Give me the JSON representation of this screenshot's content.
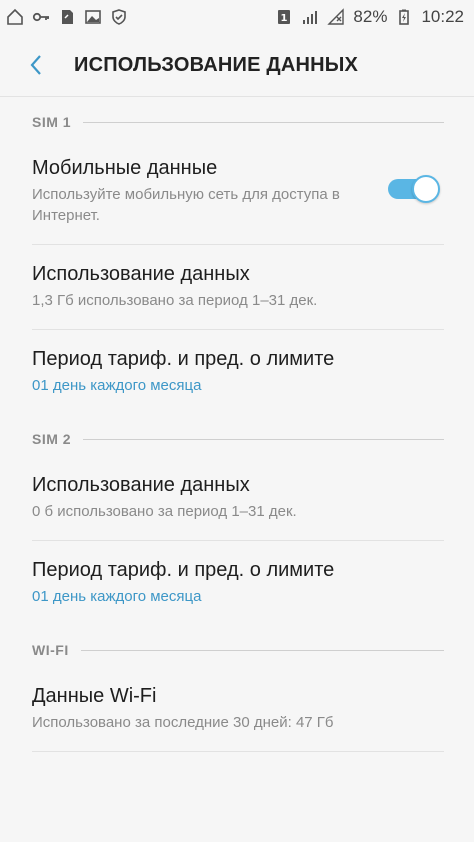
{
  "statusbar": {
    "sim_badge": "1",
    "battery": "82%",
    "time": "10:22"
  },
  "header": {
    "title": "ИСПОЛЬЗОВАНИЕ ДАННЫХ"
  },
  "sections": {
    "sim1": {
      "label": "SIM 1",
      "mobile_data": {
        "title": "Мобильные данные",
        "subtitle": "Используйте мобильную сеть для доступа в Интернет.",
        "enabled": true
      },
      "usage": {
        "title": "Использование данных",
        "subtitle": "1,3 Гб использовано за период 1–31 дек."
      },
      "billing": {
        "title": "Период тариф. и пред. о лимите",
        "subtitle": "01 день каждого месяца"
      }
    },
    "sim2": {
      "label": "SIM 2",
      "usage": {
        "title": "Использование данных",
        "subtitle": "0 б использовано за период 1–31 дек."
      },
      "billing": {
        "title": "Период тариф. и пред. о лимите",
        "subtitle": "01 день каждого месяца"
      }
    },
    "wifi": {
      "label": "WI-FI",
      "data": {
        "title": "Данные Wi-Fi",
        "subtitle": "Использовано за последние 30 дней: 47 Гб"
      }
    }
  },
  "colors": {
    "accent": "#3d97c7",
    "toggle_on": "#5ab6e4"
  }
}
